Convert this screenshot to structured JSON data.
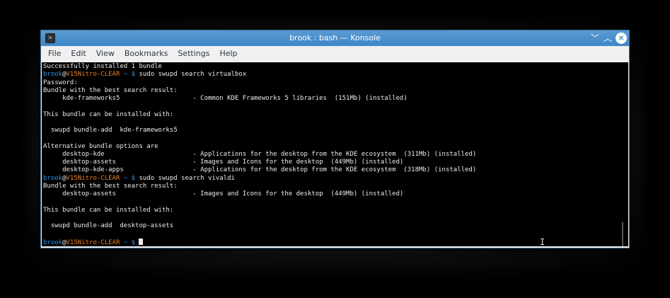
{
  "window": {
    "title": "brook : bash — Konsole",
    "app_icon": "terminal-icon",
    "app_icon_glyph": ">",
    "controls": {
      "minimize": "﹀",
      "maximize": "︿",
      "close": "×"
    }
  },
  "menu": [
    "File",
    "Edit",
    "View",
    "Bookmarks",
    "Settings",
    "Help"
  ],
  "prompt": {
    "user": "brook",
    "at": "@",
    "host": "V15Nitro-CLEAR",
    "rest": " ~ $ "
  },
  "terminal": {
    "lines": [
      {
        "type": "text",
        "text": "Successfully installed 1 bundle"
      },
      {
        "type": "prompt",
        "cmd": "sudo swupd search virtualbox"
      },
      {
        "type": "text",
        "text": "Password:"
      },
      {
        "type": "text",
        "text": "Bundle with the best search result:"
      },
      {
        "type": "text",
        "text": "     kde-frameworks5                   - Common KDE Frameworks 5 libraries  (151Mb) (installed)"
      },
      {
        "type": "text",
        "text": ""
      },
      {
        "type": "text",
        "text": "This bundle can be installed with:"
      },
      {
        "type": "text",
        "text": ""
      },
      {
        "type": "text",
        "text": "  swupd bundle-add  kde-frameworks5"
      },
      {
        "type": "text",
        "text": ""
      },
      {
        "type": "text",
        "text": "Alternative bundle options are"
      },
      {
        "type": "text",
        "text": "     desktop-kde                       - Applications for the desktop from the KDE ecosystem  (311Mb) (installed)"
      },
      {
        "type": "text",
        "text": "     desktop-assets                    - Images and Icons for the desktop  (449Mb) (installed)"
      },
      {
        "type": "text",
        "text": "     desktop-kde-apps                  - Applications for the desktop from the KDE ecosystem  (318Mb) (installed)"
      },
      {
        "type": "prompt",
        "cmd": "sudo swupd search vivaldi"
      },
      {
        "type": "text",
        "text": "Bundle with the best search result:"
      },
      {
        "type": "text",
        "text": "     desktop-assets                    - Images and Icons for the desktop  (449Mb) (installed)"
      },
      {
        "type": "text",
        "text": ""
      },
      {
        "type": "text",
        "text": "This bundle can be installed with:"
      },
      {
        "type": "text",
        "text": ""
      },
      {
        "type": "text",
        "text": "  swupd bundle-add  desktop-assets"
      },
      {
        "type": "text",
        "text": ""
      },
      {
        "type": "prompt",
        "cmd": "",
        "cursor": true
      }
    ]
  },
  "colors": {
    "user": "#2a94e8",
    "host": "#f1801f",
    "text": "#ececec",
    "titlebar": "#3e86c8"
  }
}
